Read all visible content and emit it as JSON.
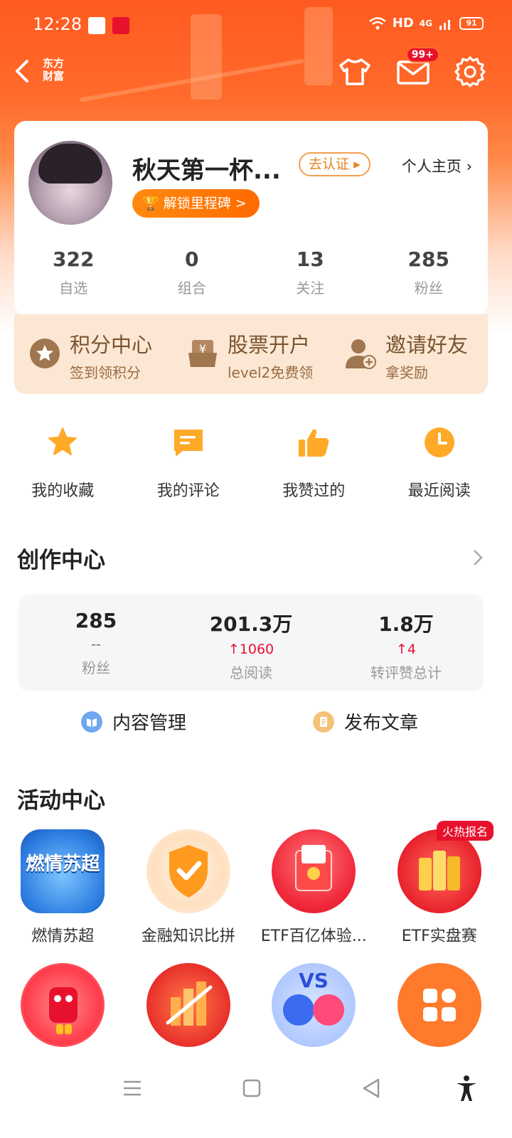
{
  "status_bar": {
    "time": "12:28",
    "network": "HD",
    "signal": "4G",
    "battery": "91"
  },
  "header": {
    "brand_line1": "东方",
    "brand_line2": "财富",
    "mail_badge": "99+"
  },
  "profile": {
    "nickname": "秋天第一杯...",
    "verify_label": "去认证",
    "homepage_label": "个人主页",
    "milestone_label": "解锁里程碑 >",
    "stats": [
      {
        "value": "322",
        "label": "自选"
      },
      {
        "value": "0",
        "label": "组合"
      },
      {
        "value": "13",
        "label": "关注"
      },
      {
        "value": "285",
        "label": "粉丝"
      }
    ]
  },
  "promo": [
    {
      "title": "积分中心",
      "subtitle": "签到领积分",
      "icon": "star-medal-icon"
    },
    {
      "title": "股票开户",
      "subtitle": "level2免费领",
      "icon": "yuan-box-icon"
    },
    {
      "title": "邀请好友",
      "subtitle": "拿奖励",
      "icon": "person-add-icon"
    }
  ],
  "quick_links": [
    {
      "label": "我的收藏",
      "icon": "star-icon"
    },
    {
      "label": "我的评论",
      "icon": "comment-icon"
    },
    {
      "label": "我赞过的",
      "icon": "thumbs-up-icon"
    },
    {
      "label": "最近阅读",
      "icon": "clock-icon"
    }
  ],
  "creator": {
    "title": "创作中心",
    "stats": [
      {
        "value": "285",
        "delta": "--",
        "label": "粉丝"
      },
      {
        "value": "201.3万",
        "delta": "↑1060",
        "label": "总阅读"
      },
      {
        "value": "1.8万",
        "delta": "↑4",
        "label": "转评赞总计"
      }
    ],
    "manage_label": "内容管理",
    "publish_label": "发布文章"
  },
  "activity": {
    "title": "活动中心",
    "hot_badge": "火热报名",
    "row1": [
      {
        "label": "燃情苏超",
        "icon_text": "燃情苏超"
      },
      {
        "label": "金融知识比拼",
        "icon_text": ""
      },
      {
        "label": "ETF百亿体验...",
        "icon_text": ""
      },
      {
        "label": "ETF实盘赛",
        "icon_text": ""
      }
    ],
    "row2": [
      {
        "label": ""
      },
      {
        "label": ""
      },
      {
        "label": ""
      },
      {
        "label": ""
      }
    ]
  },
  "colors": {
    "accent": "#ff6a00",
    "brand_orange": "#ff5a1f",
    "up_red": "#e8112d",
    "promo_bg": "#fbe7d3"
  }
}
